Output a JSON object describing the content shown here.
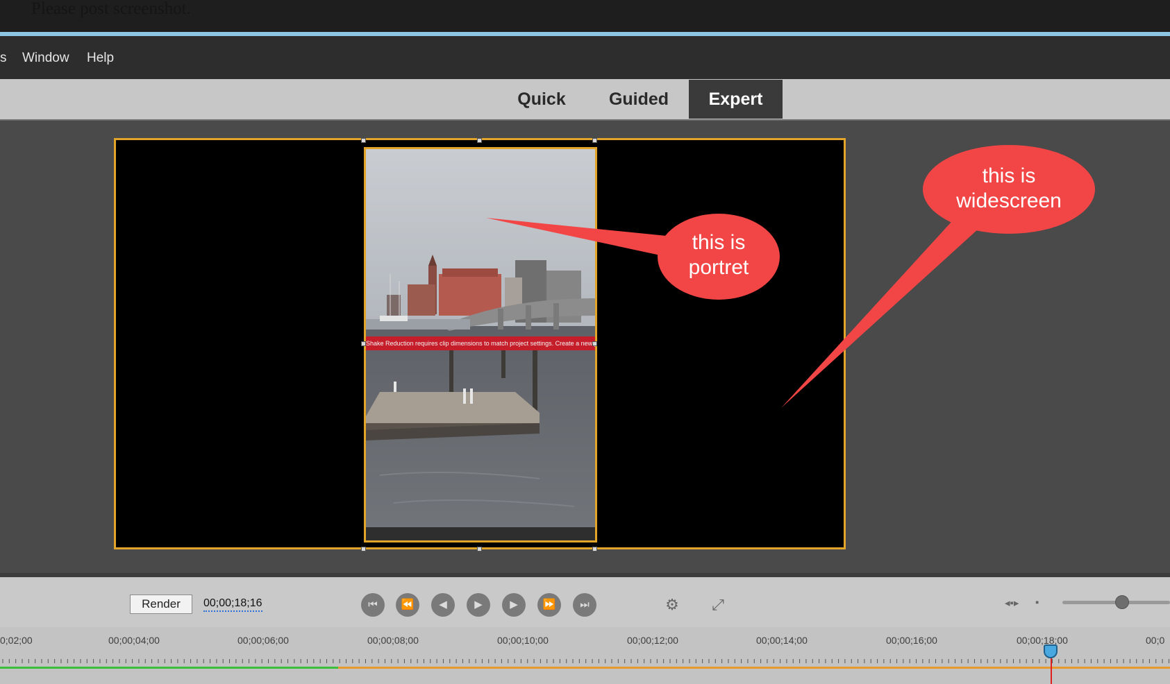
{
  "top_note": "Please post screenshot.",
  "menu": {
    "partial": "s",
    "window": "Window",
    "help": "Help"
  },
  "modes": {
    "quick": "Quick",
    "guided": "Guided",
    "expert": "Expert",
    "active": "Expert"
  },
  "monitor": {
    "warning_text": "Shake Reduction requires clip dimensions to match project settings. Create a new project.",
    "callout_portrait": "this is portret",
    "callout_widescreen": "this is widescreen"
  },
  "controls": {
    "render_label": "Render",
    "timecode": "00;00;18;16"
  },
  "transport_icons": [
    "go-to-start-icon",
    "previous-edit-icon",
    "step-back-icon",
    "play-icon",
    "step-forward-icon",
    "next-edit-icon",
    "go-to-end-icon"
  ],
  "ruler": {
    "labels": [
      "0;02;00",
      "00;00;04;00",
      "00;00;06;00",
      "00;00;08;00",
      "00;00;10;00",
      "00;00;12;00",
      "00;00;14;00",
      "00;00;16;00",
      "00;00;18;00",
      "00;0"
    ]
  },
  "colors": {
    "selection": "#e2a52a",
    "callout": "#f24545",
    "rendered": "#3bbf3b",
    "unrendered": "#e69a2e",
    "playhead": "#e02020"
  }
}
